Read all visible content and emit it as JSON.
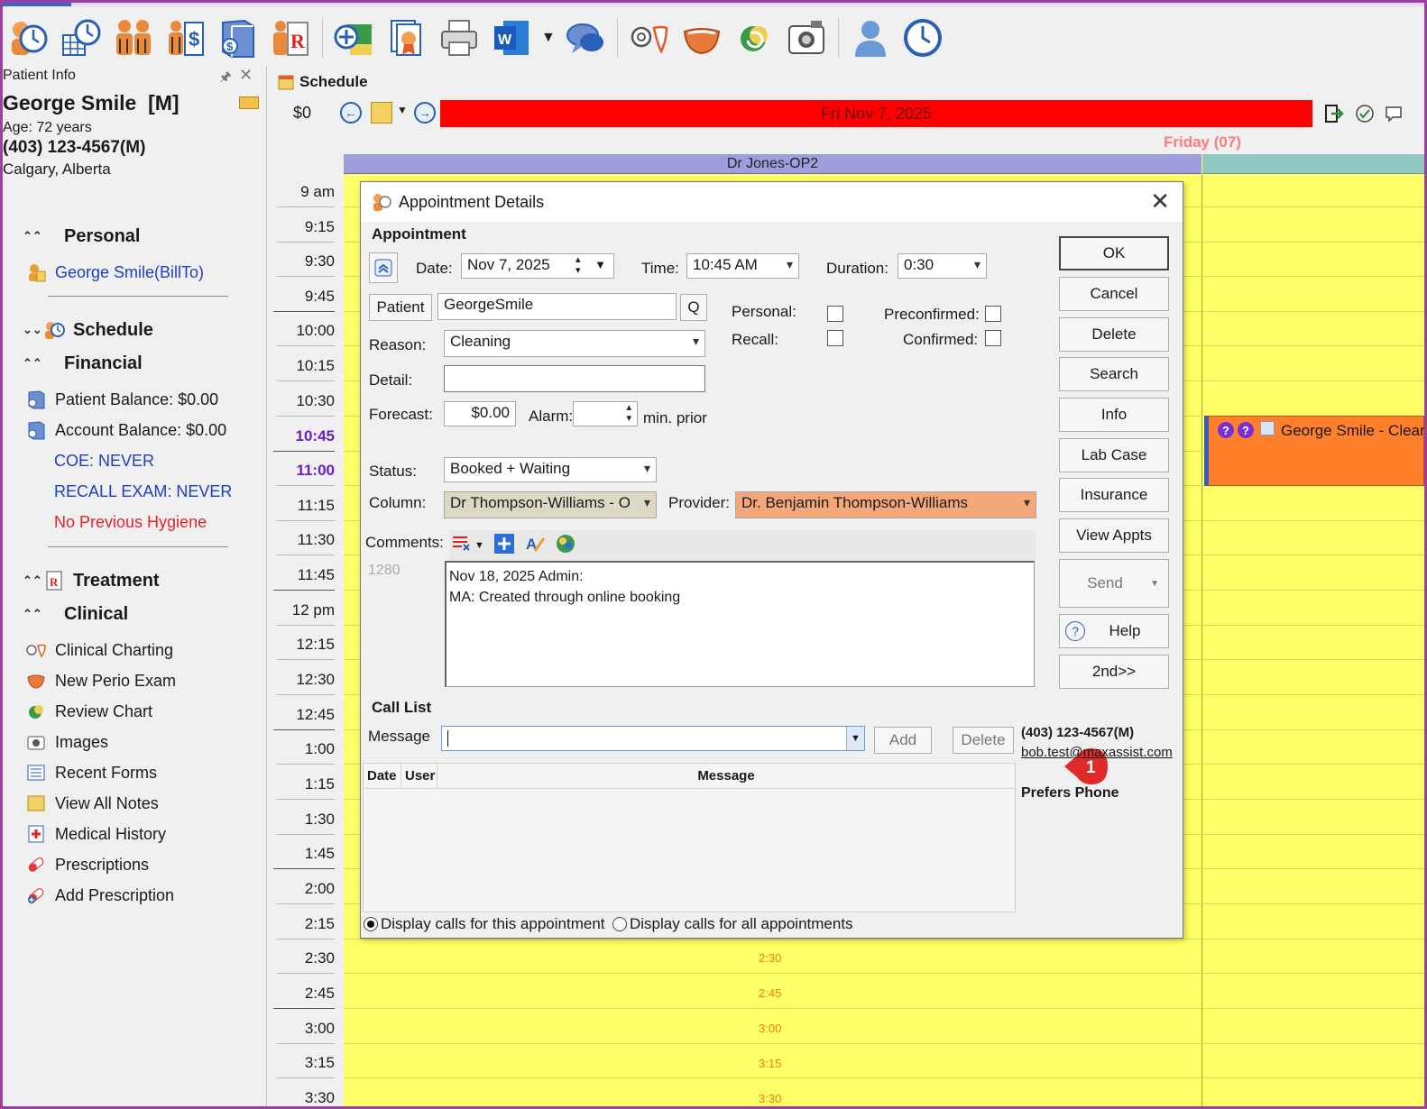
{
  "toolbar": {
    "icons": [
      "patient-clock-icon",
      "calculator-clock-icon",
      "family-icon",
      "billing-icon",
      "ledger-icon",
      "prescription-icon",
      "add-patient-icon",
      "document-badge-icon",
      "printer-icon",
      "word-icon",
      "chat-icon",
      "teeth-icon",
      "perio-icon",
      "review-icon",
      "camera-icon",
      "user-icon",
      "clock-icon"
    ]
  },
  "patient_info": {
    "header": "Patient Info",
    "name": "George Smile",
    "gender": "[M]",
    "age": "Age: 72 years",
    "phone": "(403) 123-4567(M)",
    "city": "Calgary, Alberta"
  },
  "sidebar": {
    "personal": {
      "title": "Personal",
      "bill_to": "George Smile(BillTo)"
    },
    "schedule": {
      "title": "Schedule"
    },
    "financial": {
      "title": "Financial",
      "patient_balance": "Patient Balance: $0.00",
      "account_balance": "Account Balance: $0.00",
      "coe": "COE: NEVER",
      "recall": "RECALL EXAM: NEVER",
      "hygiene": "No Previous Hygiene"
    },
    "treatment": {
      "title": "Treatment"
    },
    "clinical": {
      "title": "Clinical",
      "items": [
        "Clinical Charting",
        "New Perio Exam",
        "Review Chart",
        "Images",
        "Recent Forms",
        "View All Notes",
        "Medical History",
        "Prescriptions",
        "Add Prescription"
      ]
    }
  },
  "schedule": {
    "tab": "Schedule",
    "balance": "$0",
    "date": "Fri Nov 7, 2025",
    "day": "Friday (07)",
    "column1": "Dr Jones-OP2",
    "times": [
      "9 am",
      "9:15",
      "9:30",
      "9:45",
      "10:00",
      "10:15",
      "10:30",
      "10:45",
      "11:00",
      "11:15",
      "11:30",
      "11:45",
      "12 pm",
      "12:15",
      "12:30",
      "12:45",
      "1:00",
      "1:15",
      "1:30",
      "1:45",
      "2:00",
      "2:15",
      "2:30",
      "2:45",
      "3:00",
      "3:15",
      "3:30"
    ],
    "grid_times": [
      "2:30",
      "2:45",
      "3:00",
      "3:15",
      "3:30"
    ],
    "appointment": "George Smile - Cleaning",
    "colors": {
      "date_bar": "#ff0000",
      "grid": "#ffff66",
      "appointment": "#ff7f2a",
      "column_head": "#9e9edf",
      "current_time": "#6a1ecc"
    }
  },
  "dialog": {
    "title": "Appointment Details",
    "section": "Appointment",
    "date_label": "Date:",
    "date": "Nov 7, 2025",
    "time_label": "Time:",
    "time": "10:45 AM",
    "duration_label": "Duration:",
    "duration": "0:30",
    "patient_button": "Patient",
    "patient": "GeorgeSmile",
    "patient_search": "Q",
    "personal_label": "Personal:",
    "preconfirmed_label": "Preconfirmed:",
    "recall_label": "Recall:",
    "confirmed_label": "Confirmed:",
    "reason_label": "Reason:",
    "reason": "Cleaning",
    "detail_label": "Detail:",
    "detail": "",
    "forecast_label": "Forecast:",
    "forecast": "$0.00",
    "alarm_label": "Alarm:",
    "alarm": "",
    "alarm_suffix": "min. prior",
    "status_label": "Status:",
    "status": "Booked + Waiting",
    "column_label": "Column:",
    "column": "Dr Thompson-Williams - O",
    "provider_label": "Provider:",
    "provider": "Dr. Benjamin Thompson-Williams",
    "comments_label": "Comments:",
    "comments_count": "1280",
    "comments_line1": "Nov 18, 2025 Admin:",
    "comments_line2": "MA: Created through online booking",
    "badge": "1",
    "buttons": {
      "ok": "OK",
      "cancel": "Cancel",
      "delete": "Delete",
      "search": "Search",
      "info": "Info",
      "lab_case": "Lab Case",
      "insurance": "Insurance",
      "view_appts": "View Appts",
      "send": "Send",
      "help": "Help",
      "second": "2nd>>"
    },
    "call_list": {
      "title": "Call List",
      "message_label": "Message",
      "message": "",
      "add": "Add",
      "delete": "Delete",
      "phone": "(403) 123-4567(M)",
      "email": "bob.test@maxassist.com",
      "prefers": "Prefers Phone",
      "columns": [
        "Date",
        "User",
        "Message"
      ],
      "radio_this": "Display calls for this appointment",
      "radio_all": "Display calls for all appointments",
      "selected": "this"
    }
  }
}
